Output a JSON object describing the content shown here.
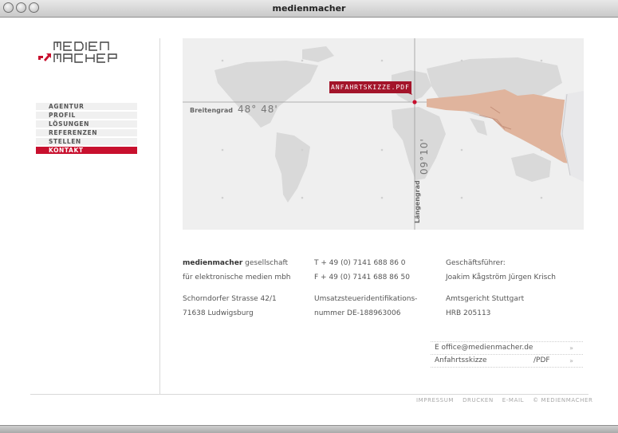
{
  "window": {
    "title": "medienmacher"
  },
  "nav": {
    "items": [
      {
        "label": "AGENTUR"
      },
      {
        "label": "PROFIL"
      },
      {
        "label": "LÖSUNGEN"
      },
      {
        "label": "REFERENZEN"
      },
      {
        "label": "STELLEN"
      },
      {
        "label": "KONTAKT",
        "active": true
      }
    ]
  },
  "map": {
    "pdf_badge": "ANFAHRTSKIZZE.PDF",
    "lat_label": "Breitengrad",
    "lat_value": "48° 48'",
    "lon_label": "Längengrad",
    "lon_value": "09°10'"
  },
  "contact": {
    "company_bold": "medienmacher",
    "company_rest": " gesellschaft",
    "company_line2": "für elektronische medien mbh",
    "street": "Schorndorfer Strasse 42/1",
    "city": "71638 Ludwigsburg",
    "phone": "T + 49 (0) 7141 688 86 0",
    "fax": "F + 49 (0) 7141 688 86 50",
    "tax_line1": "Umsatzsteueridentifikations-",
    "tax_line2": "nummer DE-188963006",
    "ceo_label": "Geschäftsführer:",
    "ceo_names": "Joakim Kågström Jürgen Krisch",
    "court": "Amtsgericht Stuttgart",
    "hrb": "HRB 205113"
  },
  "links": {
    "email": "E office@medienmacher.de",
    "email_chev": "»",
    "sketch": "Anfahrtsskizze",
    "sketch_pdf": "/PDF",
    "sketch_chev": "»"
  },
  "footer": {
    "impressum": "IMPRESSUM",
    "drucken": "DRUCKEN",
    "email": "E-MAIL",
    "copyright": "© MEDIENMACHER"
  },
  "colors": {
    "accent": "#c8102e"
  }
}
